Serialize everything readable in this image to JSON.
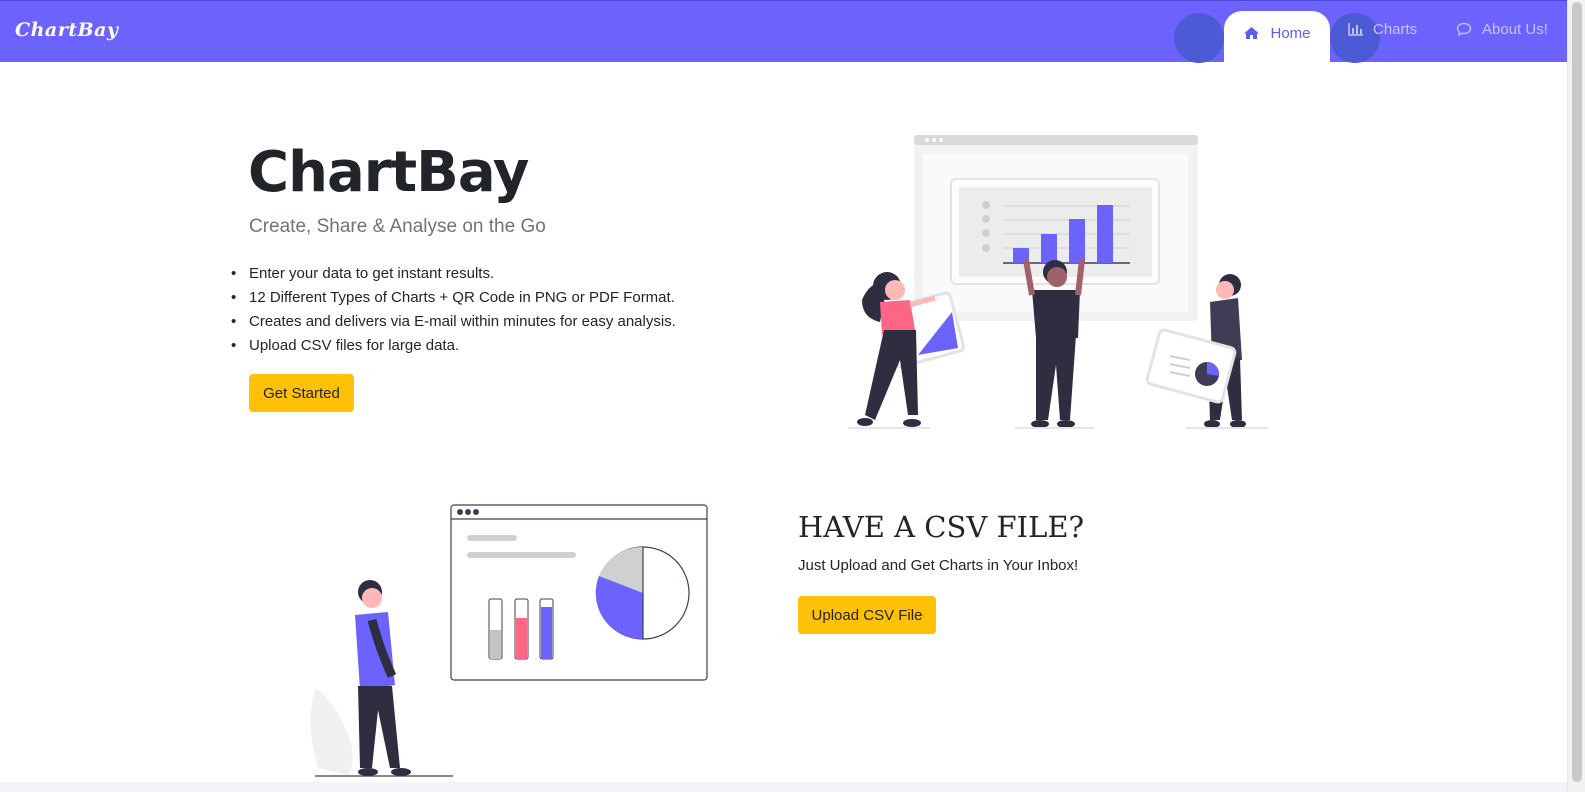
{
  "nav": {
    "brand": "ChartBay",
    "items": [
      {
        "label": "Home",
        "icon": "home-icon",
        "active": true
      },
      {
        "label": "Charts",
        "icon": "bar-chart-icon"
      },
      {
        "label": "About Us!",
        "icon": "chat-icon"
      }
    ]
  },
  "hero": {
    "title": "ChartBay",
    "subtitle": "Create, Share & Analyse on the Go",
    "features": [
      "Enter your data to get instant results.",
      "12 Different Types of Charts + QR Code in PNG or PDF Format.",
      "Creates and delivers via E-mail within minutes for easy analysis.",
      "Upload CSV files for large data."
    ],
    "cta": "Get Started"
  },
  "csv": {
    "title": "HAVE A CSV FILE?",
    "subtitle": "Just Upload and Get Charts in Your Inbox!",
    "cta": "Upload CSV File"
  },
  "colors": {
    "brand": "#6c63ff",
    "accent": "#ffc107",
    "pink": "#ff6584",
    "dark": "#2f2e41"
  }
}
